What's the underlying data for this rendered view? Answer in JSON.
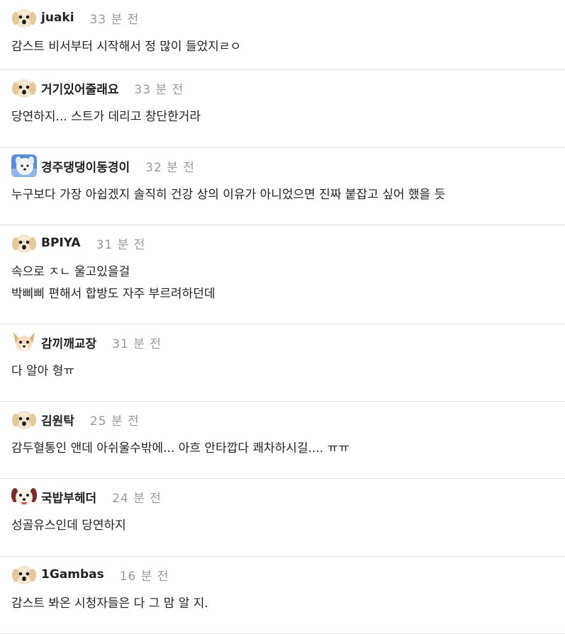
{
  "comments": [
    {
      "author": "juaki",
      "time": "33 분 전",
      "avatar_icon": "puppy-icon",
      "lines": [
        "감스트 비서부터 시작해서 정 많이 들었지ㄹㅇ"
      ]
    },
    {
      "author": "거기있어줄래요",
      "time": "33 분 전",
      "avatar_icon": "puppy-icon",
      "lines": [
        "당연하지... 스트가 데리고 창단한거라"
      ]
    },
    {
      "author": "경주댕댕이동경이",
      "time": "32 분 전",
      "avatar_icon": "white-dog-icon",
      "lines": [
        "누구보다 가장 아쉽겠지 솔직히 건강 상의 이유가 아니었으면 진짜 붙잡고 싶어 했을 듯"
      ]
    },
    {
      "author": "BPIYA",
      "time": "31 분 전",
      "avatar_icon": "puppy-icon",
      "lines": [
        "속으로 ㅈㄴ 울고있을걸",
        "박삐삐 편해서 합방도 자주 부르려하던데"
      ]
    },
    {
      "author": "감끼깨교장",
      "time": "31 분 전",
      "avatar_icon": "chihuahua-icon",
      "lines": [
        "다 알아 형ㅠ"
      ]
    },
    {
      "author": "김원탁",
      "time": "25 분 전",
      "avatar_icon": "puppy-icon",
      "lines": [
        "감두혈통인 앤데 아쉬울수밖에... 아흐 안타깝다 쾌차하시길.... ㅠㅠ"
      ]
    },
    {
      "author": "국밥부헤더",
      "time": "24 분 전",
      "avatar_icon": "red-dog-icon",
      "lines": [
        "성골유스인데 당연하지"
      ]
    },
    {
      "author": "1Gambas",
      "time": "16 분 전",
      "avatar_icon": "puppy-icon",
      "lines": [
        "감스트 봐온 시청자들은 다 그 맘 알 지."
      ]
    }
  ],
  "colors": {
    "text": "#222222",
    "time": "#999999",
    "divider": "#e2e2e2"
  }
}
